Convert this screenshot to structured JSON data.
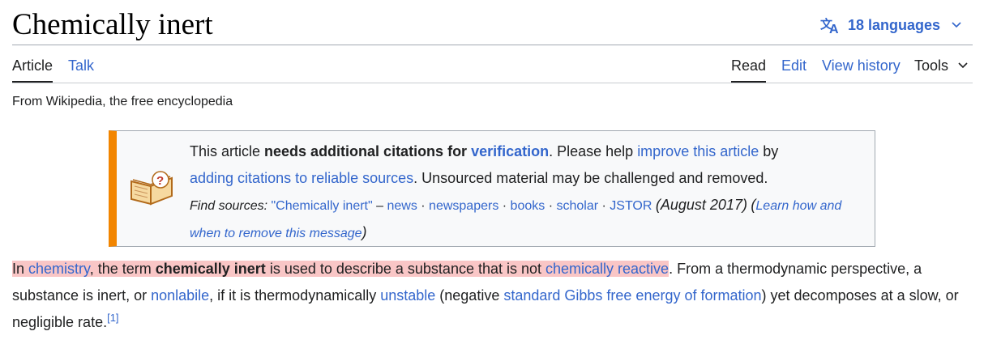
{
  "page": {
    "title": "Chemically inert",
    "languages_label": "18 languages",
    "tagline": "From Wikipedia, the free encyclopedia"
  },
  "tabs": {
    "left": [
      "Article",
      "Talk"
    ],
    "right": [
      "Read",
      "Edit",
      "View history"
    ],
    "tools": "Tools"
  },
  "ambox": {
    "icon": "book-question-icon",
    "t1": "This article ",
    "t2": "needs additional citations for",
    "t3": " ",
    "t4": "verification",
    "t5": ". Please help ",
    "t6": "improve this article",
    "t7": " by ",
    "t8": "adding citations to reliable sources",
    "t9": ". Unsourced material may be challenged and removed.",
    "find_sources": "Find sources:",
    "query": "\"Chemically inert\"",
    "dash": " – ",
    "news": "news",
    "sep": " · ",
    "newspapers": "newspapers",
    "books": "books",
    "scholar": "scholar",
    "jstor": "JSTOR",
    "date": "(August 2017)",
    "open_paren": "(",
    "learn": "Learn how and when to remove this message",
    "close_paren": ")"
  },
  "paragraph": {
    "p1": "In ",
    "chemistry": "chemistry",
    "p2": ", the term ",
    "bold": "chemically inert",
    "p3": " is used to describe a substance that is not ",
    "reactive": "chemically reactive",
    "p4": ". From a thermodynamic perspective, a substance is inert, or ",
    "nonlabile": "nonlabile",
    "p5": ", if it is thermodynamically ",
    "unstable": "unstable",
    "p6": " (negative ",
    "gibbs": "standard Gibbs free energy of formation",
    "p7": ") yet decomposes at a slow, or negligible rate.",
    "ref": "[1]"
  },
  "colors": {
    "link": "#3366cc",
    "highlight": "#f9c6c6",
    "ambox_accent": "#f28500"
  }
}
